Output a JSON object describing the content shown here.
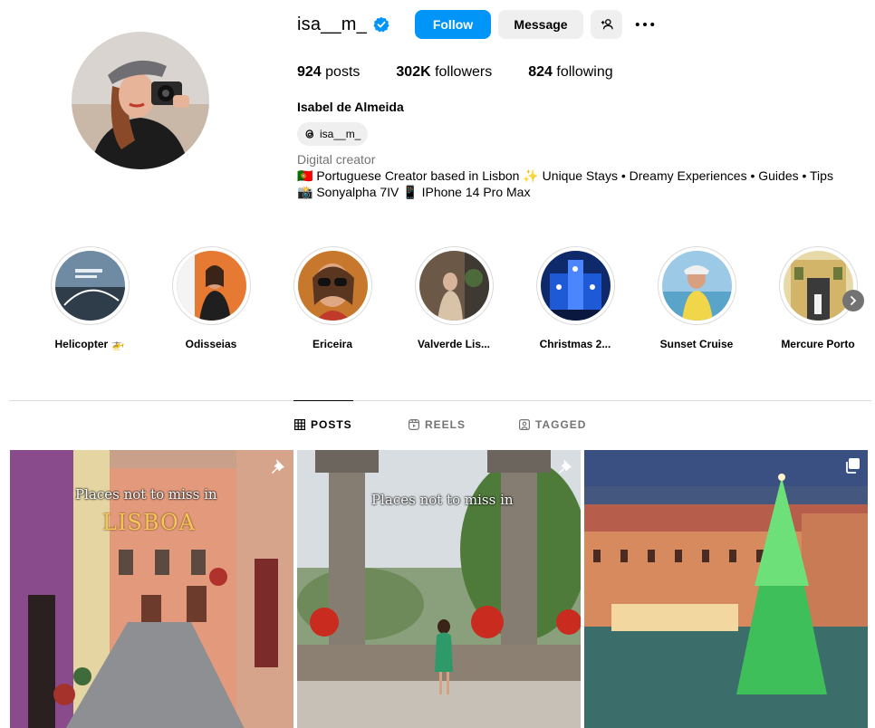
{
  "profile": {
    "username": "isa__m_",
    "follow_label": "Follow",
    "message_label": "Message",
    "posts_count": "924",
    "posts_label": " posts",
    "followers_count": "302K",
    "followers_label": " followers",
    "following_count": "824",
    "following_label": " following",
    "full_name": "Isabel de Almeida",
    "threads_handle": "isa__m_",
    "category": "Digital creator",
    "bio_line1": "🇵🇹 Portuguese Creator based in Lisbon ✨ Unique Stays • Dreamy Experiences • Guides • Tips",
    "bio_line2": "📸 Sonyalpha 7IV 📱 IPhone 14 Pro Max"
  },
  "highlights": [
    {
      "label": "Helicopter 🚁"
    },
    {
      "label": "Odisseias"
    },
    {
      "label": "Ericeira"
    },
    {
      "label": "Valverde Lis..."
    },
    {
      "label": "Christmas 2..."
    },
    {
      "label": "Sunset Cruise"
    },
    {
      "label": "Mercure Porto"
    }
  ],
  "tabs": {
    "posts": "POSTS",
    "reels": "REELS",
    "tagged": "TAGGED"
  },
  "posts": [
    {
      "overlay_line1": "Places not to miss in",
      "overlay_line2": "LISBOA",
      "badge": "pin-icon"
    },
    {
      "overlay_line1": "Places not to miss in",
      "badge": "pin-icon"
    },
    {
      "badge": "carousel-icon"
    }
  ],
  "colors": {
    "accent": "#0095f6",
    "button_gray": "#efefef",
    "muted_text": "#737373",
    "divider": "#dbdbdb"
  }
}
